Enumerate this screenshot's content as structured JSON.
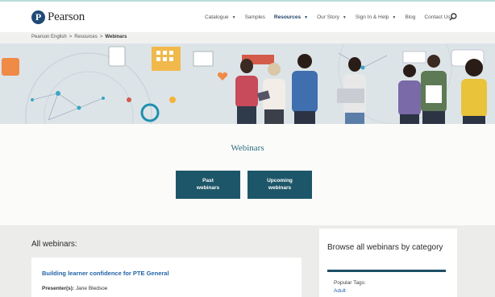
{
  "header": {
    "logo_text": "Pearson",
    "logo_letter": "P",
    "nav": [
      {
        "label": "Catalogue",
        "caret": true
      },
      {
        "label": "Samples",
        "caret": false
      },
      {
        "label": "Resources",
        "caret": true,
        "active": true
      },
      {
        "label": "Our Story",
        "caret": true
      },
      {
        "label": "Sign In & Help",
        "caret": true
      },
      {
        "label": "Blog",
        "caret": false
      },
      {
        "label": "Contact Us",
        "caret": false
      }
    ],
    "search_icon": "search-icon"
  },
  "breadcrumb": {
    "items": [
      "Pearson English",
      "Resources",
      "Webinars"
    ],
    "separator": ">"
  },
  "main": {
    "title": "Webinars",
    "buttons": {
      "past_line1": "Past",
      "past_line2": "webinars",
      "upcoming_line1": "Upcoming",
      "upcoming_line2": "webinars"
    }
  },
  "listing": {
    "heading": "All webinars:",
    "items": [
      {
        "title": "Building learner confidence for PTE General",
        "presenter_label": "Presenter(s):",
        "presenter": "Jane Bledsoe"
      }
    ]
  },
  "sidebar": {
    "title": "Browse all webinars by category",
    "tags_label": "Popular Tags:",
    "first_tag": "Adult"
  },
  "colors": {
    "brand": "#1f4a78",
    "button": "#1e5669",
    "title": "#2f6d7f",
    "link": "#2364a6"
  }
}
